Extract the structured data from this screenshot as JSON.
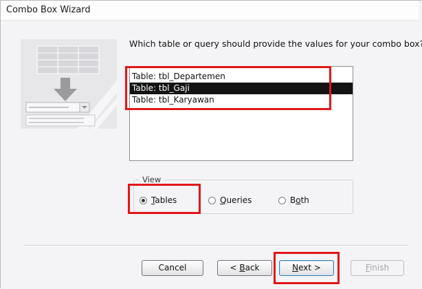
{
  "window": {
    "title": "Combo Box Wizard"
  },
  "prompt": "Which table or query should provide the values for your combo box?",
  "list": {
    "items": [
      "Table: tbl_Departemen",
      "Table: tbl_Gaji",
      "Table: tbl_Karyawan"
    ],
    "selected_index": 1
  },
  "view": {
    "legend": "View",
    "options": [
      {
        "label": "Tables",
        "mnemonic": "T",
        "rest": "ables",
        "checked": true
      },
      {
        "label": "Queries",
        "mnemonic": "Q",
        "rest": "ueries",
        "checked": false
      },
      {
        "label": "Both",
        "prefix": "B",
        "mnemonic": "o",
        "rest": "th",
        "checked": false
      }
    ]
  },
  "buttons": {
    "cancel": "Cancel",
    "back_prefix": "< ",
    "back_mnemonic": "B",
    "back_rest": "ack",
    "next_mnemonic": "N",
    "next_rest": "ext >",
    "finish_mnemonic": "F",
    "finish_rest": "inish"
  },
  "colors": {
    "highlight": "#e21616",
    "selection": "#141414"
  }
}
